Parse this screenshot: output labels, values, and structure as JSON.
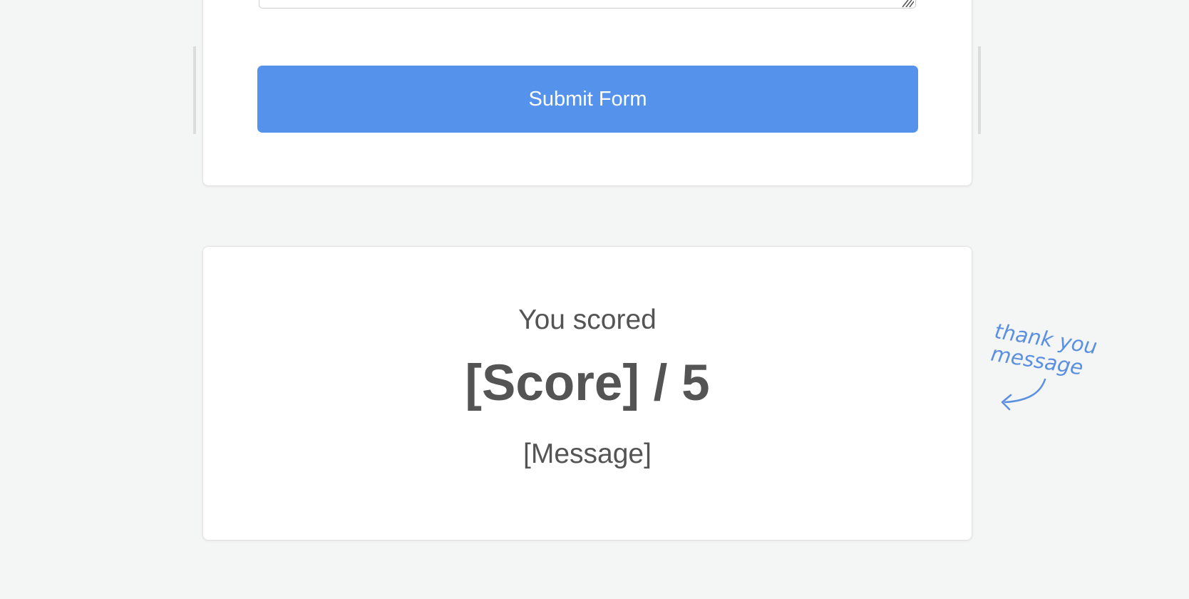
{
  "form": {
    "submit_label": "Submit Form"
  },
  "result": {
    "intro": "You scored",
    "score": "[Score] / 5",
    "message": "[Message]"
  },
  "annotation": {
    "line1": "thank you",
    "line2": "message",
    "icon": "curved-arrow-left-icon"
  },
  "colors": {
    "background": "#f4f5f5",
    "accent": "#5592ec",
    "annotation": "#5b8fe0",
    "text": "#545454"
  }
}
